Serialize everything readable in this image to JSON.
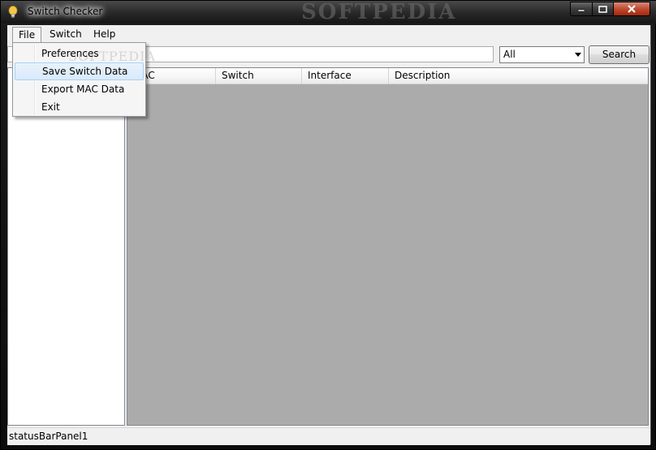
{
  "window": {
    "title": "Switch Checker",
    "watermark": "SOFTPEDIA"
  },
  "menubar": {
    "items": [
      {
        "label": "File"
      },
      {
        "label": "Switch"
      },
      {
        "label": "Help"
      }
    ]
  },
  "file_menu": {
    "items": [
      {
        "label": "Preferences"
      },
      {
        "label": "Save Switch Data"
      },
      {
        "label": "Export MAC Data"
      },
      {
        "label": "Exit"
      }
    ],
    "highlighted_index": 1,
    "watermark": "SOFTPEDIA"
  },
  "toolbar": {
    "search_value": "",
    "filter_selected": "All",
    "search_label": "Search"
  },
  "grid": {
    "columns": [
      {
        "label": "MAC"
      },
      {
        "label": "Switch"
      },
      {
        "label": "Interface"
      },
      {
        "label": "Description"
      }
    ]
  },
  "status": {
    "text": "statusBarPanel1"
  },
  "colors": {
    "grid_background": "#ababab",
    "menu_highlight": "#d9eafb",
    "close_button": "#c04a30"
  }
}
